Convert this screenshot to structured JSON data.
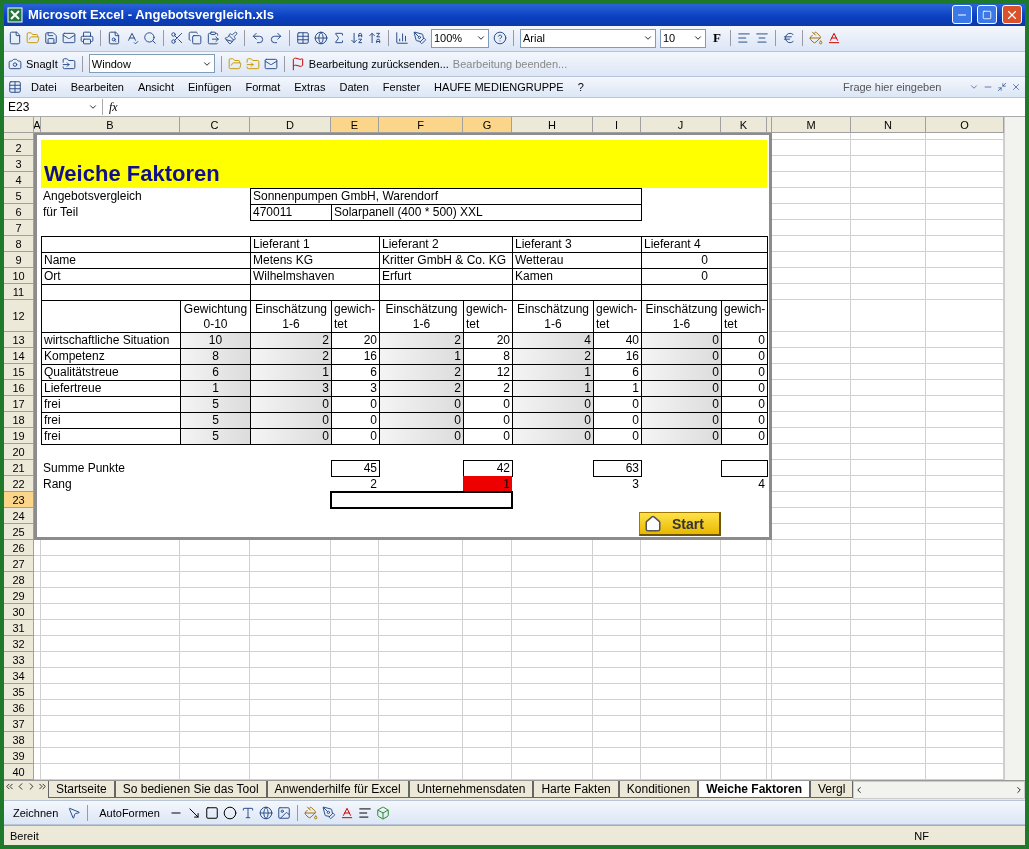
{
  "window": {
    "title": "Microsoft Excel - Angebotsvergleich.xls"
  },
  "standard_toolbar": {
    "zoom": "100%",
    "font": "Arial",
    "font_size": "10",
    "bold_label": "F"
  },
  "snagit_toolbar": {
    "label": "SnagIt",
    "window_field": "Window",
    "review_items": [
      {
        "label": "Bearbeitung zurücksenden...",
        "disabled": false
      },
      {
        "label": "Bearbeitung beenden...",
        "disabled": true
      }
    ]
  },
  "menu_bar": {
    "items": [
      "Datei",
      "Bearbeiten",
      "Ansicht",
      "Einfügen",
      "Format",
      "Extras",
      "Daten",
      "Fenster",
      "HAUFE MEDIENGRUPPE",
      "?"
    ],
    "help_placeholder": "Frage hier eingeben"
  },
  "formula_bar": {
    "name_box": "E23",
    "function_label": "fx"
  },
  "columns": [
    {
      "label": "A",
      "selected": false
    },
    {
      "label": "B",
      "selected": false
    },
    {
      "label": "C",
      "selected": false
    },
    {
      "label": "D",
      "selected": false
    },
    {
      "label": "E",
      "selected": true
    },
    {
      "label": "F",
      "selected": true
    },
    {
      "label": "G",
      "selected": true
    },
    {
      "label": "H",
      "selected": false
    },
    {
      "label": "I",
      "selected": false
    },
    {
      "label": "J",
      "selected": false
    },
    {
      "label": "K",
      "selected": false
    },
    {
      "selected": false
    },
    {
      "label": "M",
      "selected": false
    },
    {
      "label": "N",
      "selected": false
    },
    {
      "label": "O",
      "selected": false
    }
  ],
  "rows": [
    {
      "selected": false
    },
    {
      "label": "2",
      "selected": false
    },
    {
      "label": "3",
      "selected": false
    },
    {
      "label": "4",
      "selected": false
    },
    {
      "label": "5",
      "selected": false
    },
    {
      "label": "6",
      "selected": false
    },
    {
      "label": "7",
      "selected": false
    },
    {
      "label": "8",
      "selected": false
    },
    {
      "label": "9",
      "selected": false
    },
    {
      "label": "10",
      "selected": false
    },
    {
      "label": "11",
      "selected": false
    },
    {
      "label": "12",
      "selected": false,
      "tall": true
    },
    {
      "label": "13",
      "selected": false
    },
    {
      "label": "14",
      "selected": false
    },
    {
      "label": "15",
      "selected": false
    },
    {
      "label": "16",
      "selected": false
    },
    {
      "label": "17",
      "selected": false
    },
    {
      "label": "18",
      "selected": false
    },
    {
      "label": "19",
      "selected": false
    },
    {
      "label": "20",
      "selected": false
    },
    {
      "label": "21",
      "selected": false
    },
    {
      "label": "22",
      "selected": false
    },
    {
      "label": "23",
      "selected": true
    },
    {
      "label": "24",
      "selected": false
    },
    {
      "label": "25",
      "selected": false
    },
    {
      "label": "26",
      "selected": false
    },
    {
      "label": "27",
      "selected": false
    },
    {
      "label": "28",
      "selected": false
    },
    {
      "label": "29",
      "selected": false
    },
    {
      "label": "30",
      "selected": false
    },
    {
      "label": "31",
      "selected": false
    },
    {
      "label": "32",
      "selected": false
    },
    {
      "label": "33",
      "selected": false
    },
    {
      "label": "34",
      "selected": false
    },
    {
      "label": "35",
      "selected": false
    },
    {
      "label": "36",
      "selected": false
    },
    {
      "label": "37",
      "selected": false
    },
    {
      "label": "38",
      "selected": false
    },
    {
      "label": "39",
      "selected": false
    },
    {
      "label": "40",
      "selected": false
    }
  ],
  "sheet": {
    "title": "Weiche Faktoren",
    "info": [
      {
        "label": "Angebotsvergleich",
        "values": [
          "Sonnenpumpen GmbH, Warendorf"
        ]
      },
      {
        "label": "für Teil",
        "values": [
          "470011",
          "Solarpanell (400 * 500) XXL"
        ]
      }
    ],
    "row_labels": [
      "Name",
      "Ort"
    ],
    "weight_header": "Gewichtung\n0-10",
    "suppliers": [
      {
        "header": "Lieferant 1",
        "name": "Metens KG",
        "city": "Wilhelmshaven",
        "rating_header": "Einschätzung\n1-6",
        "weighted_header": "gewich-\ntet",
        "sum": "45",
        "rank": "2",
        "winner": false
      },
      {
        "header": "Lieferant 2",
        "name": "Kritter GmbH & Co. KG",
        "city": "Erfurt",
        "rating_header": "Einschätzung\n1-6",
        "weighted_header": "gewich-\ntet",
        "sum": "42",
        "rank": "1",
        "winner": true
      },
      {
        "header": "Lieferant 3",
        "name": "Wetterau",
        "city": "Kamen",
        "rating_header": "Einschätzung\n1-6",
        "weighted_header": "gewich-\ntet",
        "sum": "63",
        "rank": "3",
        "winner": false
      },
      {
        "header": "Lieferant 4",
        "name": "0",
        "city": "0",
        "rating_header": "Einschätzung\n1-6",
        "weighted_header": "gewich-\ntet",
        "rank": "4",
        "winner": false
      }
    ],
    "criteria": [
      {
        "name": "wirtschaftliche Situation",
        "weight": "10",
        "scores": [
          {
            "rating": "2",
            "weighted": "20"
          },
          {
            "rating": "2",
            "weighted": "20"
          },
          {
            "rating": "4",
            "weighted": "40"
          },
          {
            "rating": "0",
            "weighted": "0"
          }
        ]
      },
      {
        "name": "Kompetenz",
        "weight": "8",
        "scores": [
          {
            "rating": "2",
            "weighted": "16"
          },
          {
            "rating": "1",
            "weighted": "8"
          },
          {
            "rating": "2",
            "weighted": "16"
          },
          {
            "rating": "0",
            "weighted": "0"
          }
        ]
      },
      {
        "name": "Qualitätstreue",
        "weight": "6",
        "scores": [
          {
            "rating": "1",
            "weighted": "6"
          },
          {
            "rating": "2",
            "weighted": "12"
          },
          {
            "rating": "1",
            "weighted": "6"
          },
          {
            "rating": "0",
            "weighted": "0"
          }
        ]
      },
      {
        "name": "Liefertreue",
        "weight": "1",
        "scores": [
          {
            "rating": "3",
            "weighted": "3"
          },
          {
            "rating": "2",
            "weighted": "2"
          },
          {
            "rating": "1",
            "weighted": "1"
          },
          {
            "rating": "0",
            "weighted": "0"
          }
        ]
      },
      {
        "name": "frei",
        "weight": "5",
        "scores": [
          {
            "rating": "0",
            "weighted": "0"
          },
          {
            "rating": "0",
            "weighted": "0"
          },
          {
            "rating": "0",
            "weighted": "0"
          },
          {
            "rating": "0",
            "weighted": "0"
          }
        ]
      },
      {
        "name": "frei",
        "weight": "5",
        "scores": [
          {
            "rating": "0",
            "weighted": "0"
          },
          {
            "rating": "0",
            "weighted": "0"
          },
          {
            "rating": "0",
            "weighted": "0"
          },
          {
            "rating": "0",
            "weighted": "0"
          }
        ]
      },
      {
        "name": "frei",
        "weight": "5",
        "scores": [
          {
            "rating": "0",
            "weighted": "0"
          },
          {
            "rating": "0",
            "weighted": "0"
          },
          {
            "rating": "0",
            "weighted": "0"
          },
          {
            "rating": "0",
            "weighted": "0"
          }
        ]
      }
    ],
    "sum_label": "Summe Punkte",
    "rank_label": "Rang",
    "start_button": "Start"
  },
  "sheet_tabs": [
    {
      "label": "Startseite",
      "selected": false
    },
    {
      "label": "So bedienen Sie das Tool",
      "selected": false
    },
    {
      "label": "Anwenderhilfe für Excel",
      "selected": false
    },
    {
      "label": "Unternehmensdaten",
      "selected": false
    },
    {
      "label": "Harte Fakten",
      "selected": false
    },
    {
      "label": "Konditionen",
      "selected": false
    },
    {
      "label": "Weiche Faktoren",
      "selected": true
    },
    {
      "label": "Vergl",
      "selected": false
    }
  ],
  "drawing_toolbar": {
    "items": [
      "Zeichnen",
      "AutoFormen"
    ]
  },
  "status_bar": {
    "left": "Bereit",
    "right": "NF"
  }
}
